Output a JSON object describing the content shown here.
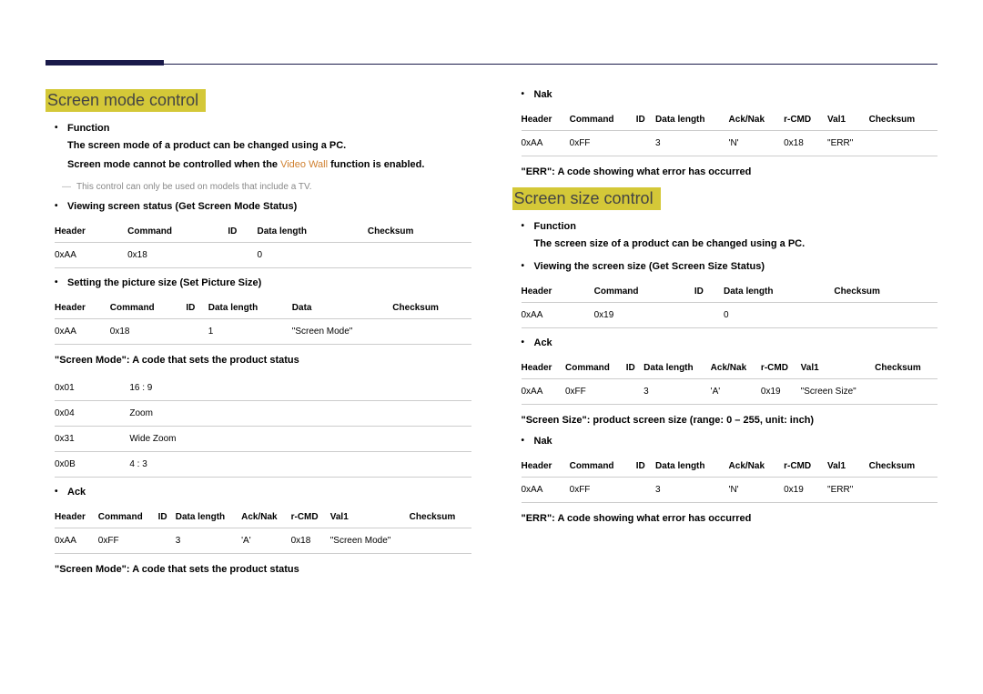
{
  "sections": {
    "screen_mode": {
      "title": "Screen mode control",
      "function_label": "Function",
      "function_desc1": "The screen mode of a product can be changed using a PC.",
      "function_desc2_pre": "Screen mode cannot be controlled when the ",
      "function_desc2_orange": "Video Wall",
      "function_desc2_post": " function is enabled.",
      "note": "This control can only be used on models that include a TV.",
      "viewing_label": "Viewing screen status (Get Screen Mode Status)",
      "view_table": {
        "headers": [
          "Header",
          "Command",
          "ID",
          "Data length",
          "Checksum"
        ],
        "row": [
          "0xAA",
          "0x18",
          "",
          "0",
          ""
        ]
      },
      "setting_label": "Setting the picture size (Set Picture Size)",
      "set_table": {
        "headers": [
          "Header",
          "Command",
          "ID",
          "Data length",
          "Data",
          "Checksum"
        ],
        "row": [
          "0xAA",
          "0x18",
          "",
          "1",
          "\"Screen Mode\"",
          ""
        ]
      },
      "modes_paragraph": "\"Screen Mode\": A code that sets the product status",
      "modes": [
        [
          "0x01",
          "16 : 9"
        ],
        [
          "0x04",
          "Zoom"
        ],
        [
          "0x31",
          "Wide Zoom"
        ],
        [
          "0x0B",
          "4 : 3"
        ]
      ],
      "ack_label": "Ack",
      "ack_table": {
        "headers": [
          "Header",
          "Command",
          "ID",
          "Data length",
          "Ack/Nak",
          "r-CMD",
          "Val1",
          "Checksum"
        ],
        "row": [
          "0xAA",
          "0xFF",
          "",
          "3",
          "'A'",
          "0x18",
          "\"Screen Mode\"",
          ""
        ]
      },
      "ack_paragraph": "\"Screen Mode\": A code that sets the product status",
      "nak_label": "Nak",
      "nak_table": {
        "headers": [
          "Header",
          "Command",
          "ID",
          "Data length",
          "Ack/Nak",
          "r-CMD",
          "Val1",
          "Checksum"
        ],
        "row": [
          "0xAA",
          "0xFF",
          "",
          "3",
          "'N'",
          "0x18",
          "\"ERR\"",
          ""
        ]
      },
      "nak_paragraph": "\"ERR\": A code showing what error has occurred"
    },
    "screen_size": {
      "title": "Screen size control",
      "function_label": "Function",
      "function_desc": "The screen size of a product can be changed using a PC.",
      "viewing_label": "Viewing the screen size (Get Screen Size Status)",
      "view_table": {
        "headers": [
          "Header",
          "Command",
          "ID",
          "Data length",
          "Checksum"
        ],
        "row": [
          "0xAA",
          "0x19",
          "",
          "0",
          ""
        ]
      },
      "ack_label": "Ack",
      "ack_table": {
        "headers": [
          "Header",
          "Command",
          "ID",
          "Data length",
          "Ack/Nak",
          "r-CMD",
          "Val1",
          "Checksum"
        ],
        "row": [
          "0xAA",
          "0xFF",
          "",
          "3",
          "'A'",
          "0x19",
          "\"Screen Size\"",
          ""
        ]
      },
      "size_paragraph": "\"Screen Size\": product screen size (range: 0 – 255, unit: inch)",
      "nak_label": "Nak",
      "nak_table": {
        "headers": [
          "Header",
          "Command",
          "ID",
          "Data length",
          "Ack/Nak",
          "r-CMD",
          "Val1",
          "Checksum"
        ],
        "row": [
          "0xAA",
          "0xFF",
          "",
          "3",
          "'N'",
          "0x19",
          "\"ERR\"",
          ""
        ]
      },
      "nak_paragraph": "\"ERR\": A code showing what error has occurred"
    }
  }
}
